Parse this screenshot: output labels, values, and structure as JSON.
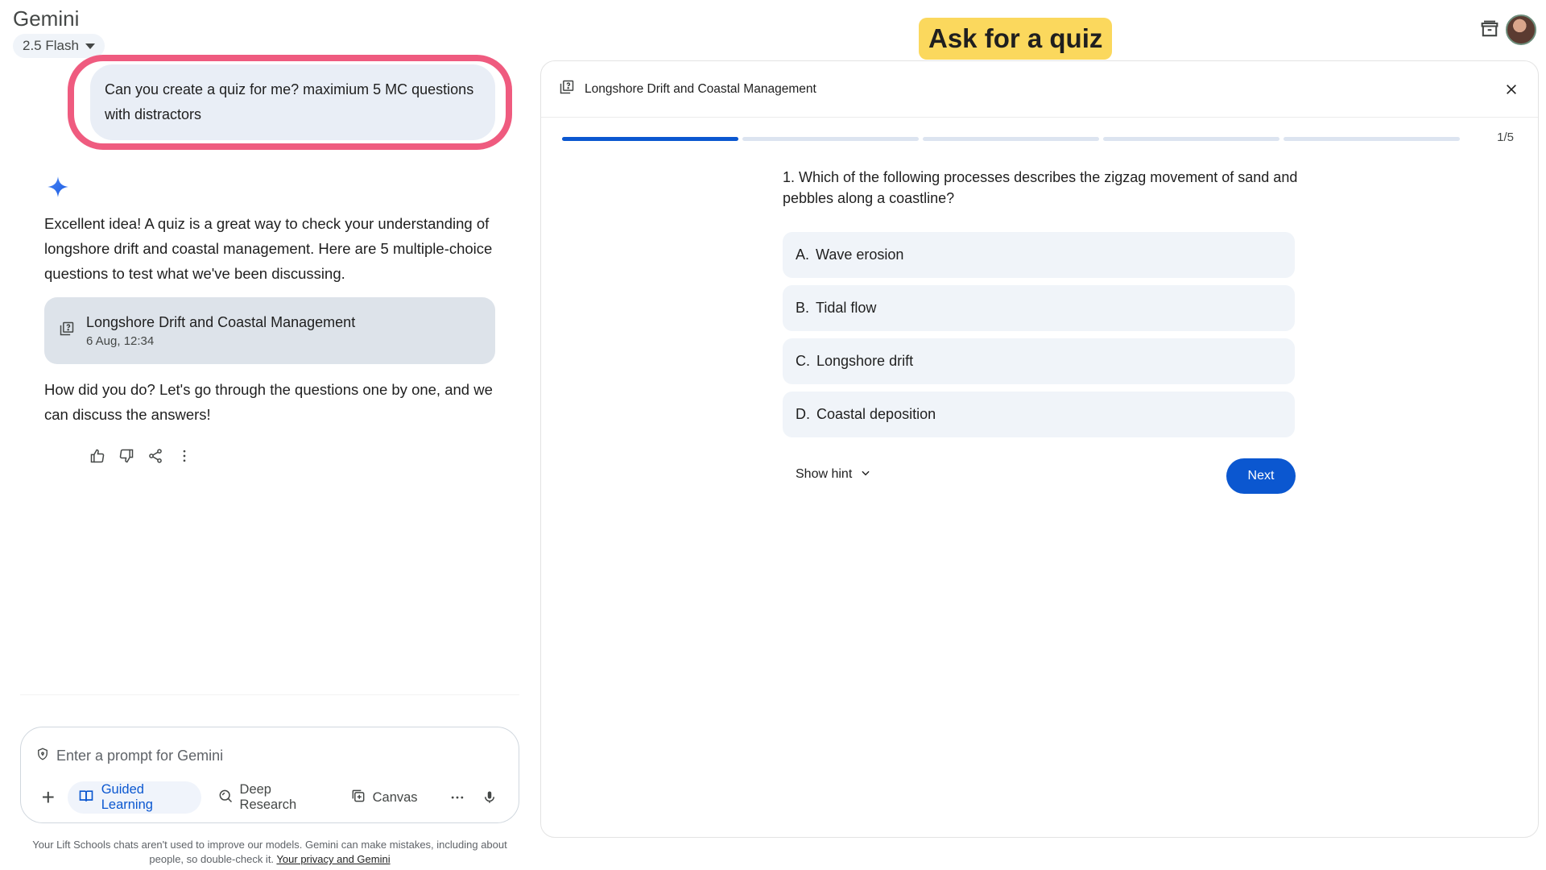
{
  "app": {
    "title": "Gemini",
    "model": "2.5 Flash"
  },
  "overlay": {
    "caption": "Ask for a quiz"
  },
  "conversation": {
    "user_message": "Can you create a quiz for me? maximium 5 MC questions with distractors",
    "response_intro": "Excellent idea! A quiz is a great way to check your understanding of longshore drift and coastal management. Here are 5 multiple-choice questions to test what we've been discussing.",
    "quiz_card": {
      "title": "Longshore Drift and Coastal Management",
      "date": "6 Aug, 12:34"
    },
    "response_followup": "How did you do? Let's go through the questions one by one, and we can discuss the answers!"
  },
  "prompt": {
    "placeholder": "Enter a prompt for Gemini",
    "tools": {
      "guided_learning": "Guided Learning",
      "deep_research": "Deep Research",
      "canvas": "Canvas"
    }
  },
  "footer": {
    "note": "Your Lift Schools chats aren't used to improve our models. Gemini can make mistakes, including about people, so double-check it.",
    "link": "Your privacy and Gemini"
  },
  "quiz_panel": {
    "title": "Longshore Drift and Coastal Management",
    "progress": {
      "current": 1,
      "total": 5,
      "label": "1/5"
    },
    "question": "1. Which of the following processes describes the zigzag movement of sand and pebbles along a coastline?",
    "options": [
      {
        "letter": "A.",
        "text": "Wave erosion"
      },
      {
        "letter": "B.",
        "text": "Tidal flow"
      },
      {
        "letter": "C.",
        "text": "Longshore drift"
      },
      {
        "letter": "D.",
        "text": "Coastal deposition"
      }
    ],
    "hint_label": "Show hint",
    "next_label": "Next"
  },
  "colors": {
    "accent": "#0b57d0",
    "highlight_ring": "#ef5b7f",
    "caption_bg": "#fbd85d",
    "bubble_bg": "#e9eef6",
    "option_bg": "#f0f4f9"
  },
  "icons": [
    "caret-down-icon",
    "archive-icon",
    "sparkle-icon",
    "quiz-icon",
    "thumbs-up-icon",
    "thumbs-down-icon",
    "share-icon",
    "more-vert-icon",
    "plus-icon",
    "guided-learning-icon",
    "deep-research-icon",
    "canvas-icon",
    "more-horiz-icon",
    "mic-icon",
    "close-icon",
    "chevron-down-icon"
  ]
}
